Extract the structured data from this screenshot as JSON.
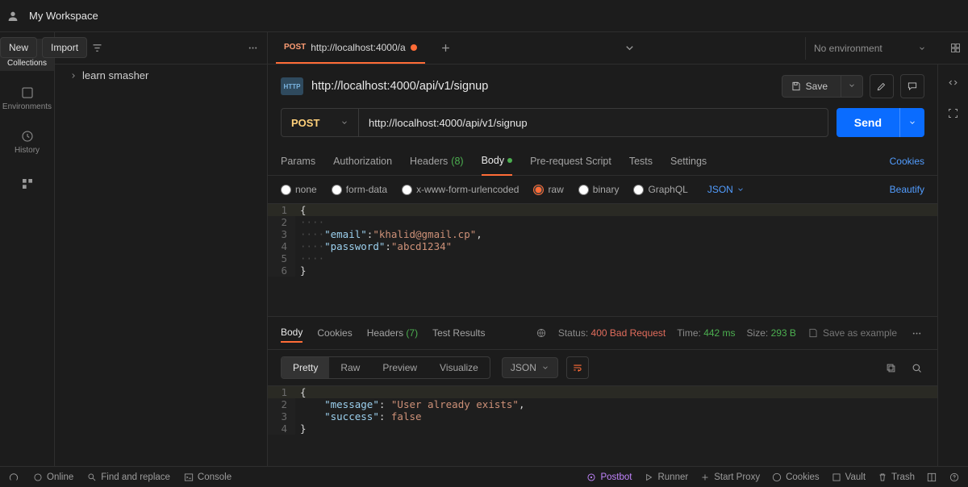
{
  "topbar": {
    "workspace": "My Workspace",
    "new": "New",
    "import": "Import"
  },
  "activity": {
    "collections": "Collections",
    "environments": "Environments",
    "history": "History"
  },
  "sidebar": {
    "collection": "learn smasher"
  },
  "reqtab": {
    "method": "POST",
    "title": "http://localhost:4000/a"
  },
  "env": {
    "selected": "No environment"
  },
  "request": {
    "title": "http://localhost:4000/api/v1/signup",
    "save": "Save",
    "method": "POST",
    "url": "http://localhost:4000/api/v1/signup",
    "send": "Send"
  },
  "subtabs": {
    "params": "Params",
    "auth": "Authorization",
    "headers": "Headers",
    "headers_count": "(8)",
    "body": "Body",
    "prereq": "Pre-request Script",
    "tests": "Tests",
    "settings": "Settings",
    "cookies": "Cookies"
  },
  "bodyopts": {
    "none": "none",
    "formdata": "form-data",
    "urlencoded": "x-www-form-urlencoded",
    "raw": "raw",
    "binary": "binary",
    "graphql": "GraphQL",
    "json": "JSON",
    "beautify": "Beautify"
  },
  "reqbody": {
    "l1": "{",
    "l2_dots": "····",
    "l3_dots": "····",
    "l3_key": "\"email\"",
    "l3_val": "\"khalid@gmail.cp\"",
    "l4_dots": "····",
    "l4_key": "\"password\"",
    "l4_val": "\"abcd1234\"",
    "l5_dots": "····",
    "l6": "}"
  },
  "resptabs": {
    "body": "Body",
    "cookies": "Cookies",
    "headers": "Headers",
    "headers_count": "(7)",
    "tests": "Test Results"
  },
  "respmeta": {
    "status_lbl": "Status:",
    "status_val": "400 Bad Request",
    "time_lbl": "Time:",
    "time_val": "442 ms",
    "size_lbl": "Size:",
    "size_val": "293 B",
    "save_ex": "Save as example"
  },
  "respview": {
    "pretty": "Pretty",
    "raw": "Raw",
    "preview": "Preview",
    "visualize": "Visualize",
    "json": "JSON"
  },
  "respbody": {
    "l1": "{",
    "l2_key": "\"message\"",
    "l2_val": "\"User already exists\"",
    "l3_key": "\"success\"",
    "l3_val": "false",
    "l4": "}"
  },
  "status": {
    "online": "Online",
    "find": "Find and replace",
    "console": "Console",
    "postbot": "Postbot",
    "runner": "Runner",
    "proxy": "Start Proxy",
    "cookies": "Cookies",
    "vault": "Vault",
    "trash": "Trash"
  }
}
